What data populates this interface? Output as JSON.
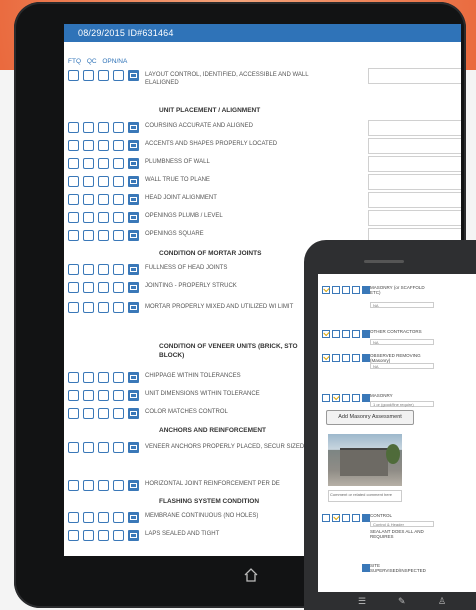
{
  "tablet": {
    "header": "08/29/2015 ID#631464",
    "legend": [
      "FTQ",
      "QC",
      "OPN/NA"
    ],
    "rows": [
      {
        "label": "LAYOUT CONTROL, IDENTIFIED, ACCESSIBLE AND WALL ELALIGNED"
      },
      {
        "label": "COURSING ACCURATE AND ALIGNED"
      },
      {
        "label": "ACCENTS AND SHAPES PROPERLY LOCATED"
      },
      {
        "label": "PLUMBNESS OF WALL"
      },
      {
        "label": "WALL TRUE TO PLANE"
      },
      {
        "label": "HEAD JOINT ALIGNMENT"
      },
      {
        "label": "OPENINGS PLUMB / LEVEL"
      },
      {
        "label": "OPENINGS SQUARE"
      },
      {
        "label": "FULLNESS OF HEAD JOINTS"
      },
      {
        "label": "JOINTING - PROPERLY STRUCK"
      },
      {
        "label": "MORTAR PROPERLY MIXED AND UTILIZED WI LIMIT"
      },
      {
        "label": "CHIPPAGE WITHIN TOLERANCES"
      },
      {
        "label": "UNIT DIMENSIONS WITHIN TOLERANCE"
      },
      {
        "label": "COLOR MATCHES CONTROL"
      },
      {
        "label": "VENEER ANCHORS PROPERLY PLACED, SECUR SIZED"
      },
      {
        "label": "HORIZONTAL JOINT REINFORCEMENT PER DE"
      },
      {
        "label": "MEMBRANE CONTINUOUS (NO HOLES)"
      },
      {
        "label": "LAPS SEALED AND TIGHT"
      }
    ],
    "sections": [
      "UNIT PLACEMENT / ALIGNMENT",
      "CONDITION OF MORTAR JOINTS",
      "CONDITION OF VENEER UNITS (BRICK, STO BLOCK)",
      "ANCHORS AND REINFORCEMENT",
      "FLASHING SYSTEM CONDITION"
    ]
  },
  "phone": {
    "add_button": "Add Masonry Assessment",
    "rows": [
      {
        "label": "MASONRY (or SCAFFOLD ETC)",
        "field": "NA"
      },
      {
        "label": "OTHER CONTRACTORS",
        "field": "NA"
      },
      {
        "label": "OBSERVED REMOVING (Masonry)",
        "field": "NA"
      },
      {
        "label": "MASONRY",
        "field": "1 or (good/fine require)"
      },
      {
        "label": "CONTROL",
        "field": "Control & Header"
      },
      {
        "label": "SITE SUPERVISED/INSPECTED",
        "field": ""
      }
    ],
    "caption": "Comment or related comment here",
    "control_note": "SEALANT DOES ALL AND REQUIRES"
  }
}
